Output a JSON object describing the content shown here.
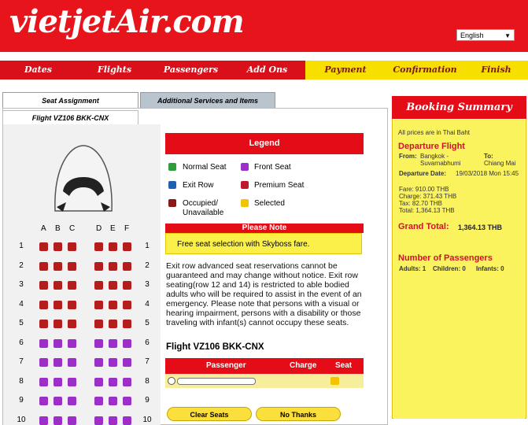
{
  "header": {
    "logo": "vietjetAir.com",
    "language": "English"
  },
  "steps": [
    "Dates",
    "Flights",
    "Passengers",
    "Add Ons",
    "Payment",
    "Confirmation",
    "Finish"
  ],
  "tabs": [
    "Seat Assignment",
    "Additional Services and Items"
  ],
  "subtab": "Flight VZ106 BKK-CNX",
  "seat_columns": [
    "A",
    "B",
    "C",
    "D",
    "E",
    "F"
  ],
  "rows": [
    {
      "num": "1",
      "state": "occupied"
    },
    {
      "num": "2",
      "state": "occupied"
    },
    {
      "num": "3",
      "state": "occupied"
    },
    {
      "num": "4",
      "state": "occupied"
    },
    {
      "num": "5",
      "state": "occupied"
    },
    {
      "num": "6",
      "state": "normal"
    },
    {
      "num": "7",
      "state": "normal"
    },
    {
      "num": "8",
      "state": "normal"
    },
    {
      "num": "9",
      "state": "normal"
    },
    {
      "num": "10",
      "state": "normal"
    }
  ],
  "legend": {
    "title": "Legend",
    "items": {
      "normal": "Normal Seat",
      "front": "Front Seat",
      "exit": "Exit Row",
      "premium": "Premium Seat",
      "occupied": "Occupied/ Unavailable",
      "selected": "Selected"
    }
  },
  "note": {
    "title": "Please Note",
    "text": "Free seat selection with Skyboss fare."
  },
  "exit_text": "Exit row advanced seat reservations cannot be guaranteed and may change without notice. Exit row seating(row 12 and 14) is restricted to able bodied adults who will be required to assist in the event of an emergency. Please note that persons with a visual or hearing impairment, persons with a disability or those traveling with infant(s) cannot occupy these seats.",
  "flight_title": "Flight VZ106 BKK-CNX",
  "table": {
    "passenger": "Passenger",
    "charge": "Charge",
    "seat": "Seat"
  },
  "buttons": {
    "clear": "Clear Seats",
    "no_thanks": "No Thanks"
  },
  "booking": {
    "title": "Booking Summary",
    "prices_note": "All prices are in Thai Baht",
    "departure": "Departure Flight",
    "from_label": "From:",
    "from": "Bangkok - Suvarnabhumi",
    "to_label": "To:",
    "to": "Chiang Mai",
    "date_label": "Departure Date:",
    "date": "19/03/2018 Mon 15:45",
    "fare": "Fare: 910.00 THB",
    "charge": "Charge: 371.43 THB",
    "tax": "Tax: 82.70 THB",
    "total": "Total: 1,364.13 THB",
    "grand_label": "Grand Total:",
    "grand_value": "1,364.13 THB",
    "passengers_title": "Number of Passengers",
    "adults": "Adults: 1",
    "children": "Children: 0",
    "infants": "Infants: 0"
  },
  "colors": {
    "brand_red": "#e30c17",
    "yellow": "#fbf04a",
    "occupied": "#b51c1c",
    "normal": "#9b2fc7"
  }
}
